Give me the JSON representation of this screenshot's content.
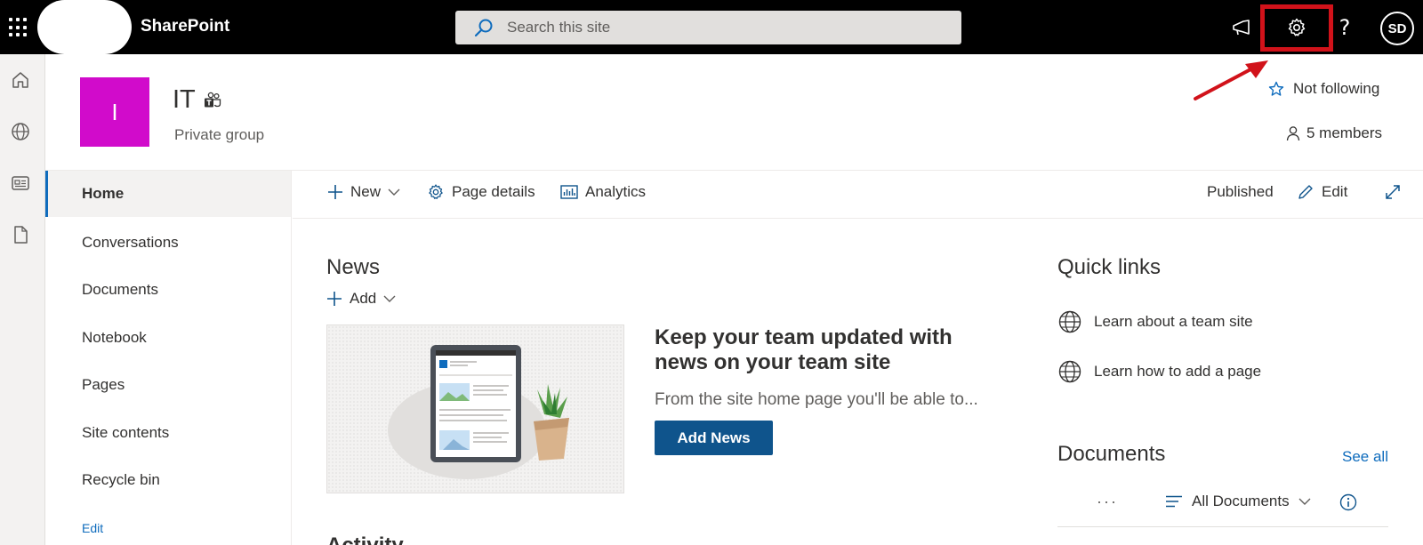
{
  "suite": {
    "app_name": "SharePoint",
    "search_placeholder": "Search this site",
    "avatar_initials": "SD",
    "icons": [
      "app-launcher-icon",
      "megaphone-icon",
      "settings-gear-icon",
      "help-icon"
    ]
  },
  "site": {
    "logo_letter": "I",
    "title": "IT",
    "subtitle": "Private group",
    "logo_color": "#d10bcb",
    "follow_label": "Not following",
    "members_label": "5 members"
  },
  "rail": {
    "icons": [
      "home-icon",
      "globe-icon",
      "news-icon",
      "document-icon"
    ]
  },
  "nav": {
    "items": [
      {
        "label": "Home"
      },
      {
        "label": "Conversations"
      },
      {
        "label": "Documents"
      },
      {
        "label": "Notebook"
      },
      {
        "label": "Pages"
      },
      {
        "label": "Site contents"
      },
      {
        "label": "Recycle bin"
      }
    ],
    "edit_label": "Edit"
  },
  "commandbar": {
    "new_label": "New",
    "page_details_label": "Page details",
    "analytics_label": "Analytics",
    "status_label": "Published",
    "edit_label": "Edit"
  },
  "news": {
    "title": "News",
    "add_label": "Add",
    "headline": "Keep your team updated with news on your team site",
    "description": "From the site home page you'll be able to...",
    "button_label": "Add News"
  },
  "activity": {
    "title": "Activity"
  },
  "quick_links": {
    "title": "Quick links",
    "items": [
      {
        "label": "Learn about a team site"
      },
      {
        "label": "Learn how to add a page"
      }
    ]
  },
  "documents": {
    "title": "Documents",
    "see_all_label": "See all",
    "more_label": "···",
    "view_label": "All Documents"
  },
  "colors": {
    "accent": "#0f6cbd",
    "primary_button": "#0f548c",
    "highlight": "#d1121a"
  }
}
